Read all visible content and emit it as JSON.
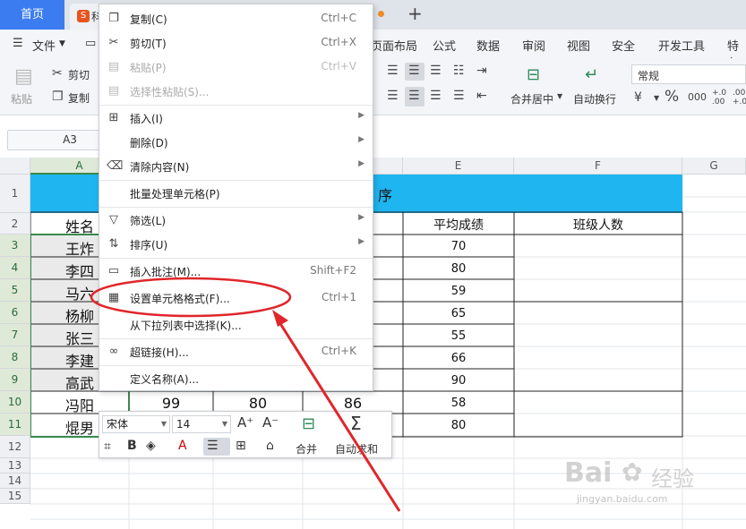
{
  "tabs": {
    "home": "首页",
    "doc_icon": "S",
    "doc_partial": "科"
  },
  "menu": [
    "文件",
    "页面布局",
    "公式",
    "数据",
    "审阅",
    "视图",
    "安全",
    "开发工具",
    "特色"
  ],
  "toolbar": {
    "paste": "粘贴",
    "cut": "剪切",
    "copy": "复制",
    "merge": "合并居中",
    "wrap": "自动换行",
    "number_format": "常规",
    "percent": "%",
    "thousands": "000",
    "inc_dec": "+.0 .00",
    "dec_dec": ".00 +.0"
  },
  "formula": {
    "name_box": "A3"
  },
  "columns": [
    "A",
    "E",
    "F",
    "G"
  ],
  "rows": [
    "1",
    "2",
    "3",
    "4",
    "5",
    "6",
    "7",
    "8",
    "9",
    "10",
    "11",
    "12",
    "13",
    "14",
    "15"
  ],
  "sheet": {
    "title_partial": "序",
    "col_a_header": "姓名",
    "avg_header": "平均成绩",
    "class_header": "班级人数",
    "names": [
      "王炸",
      "李四",
      "马六",
      "杨柳",
      "张三",
      "李建",
      "高武",
      "冯阳",
      "焜男"
    ],
    "averages": [
      "70",
      "80",
      "59",
      "65",
      "55",
      "66",
      "90",
      "58",
      "80"
    ],
    "row10": {
      "b": "99",
      "c": "80",
      "d": "86"
    }
  },
  "context_menu": [
    {
      "icon": "copy-icon",
      "label": "复制(C)",
      "shortcut": "Ctrl+C"
    },
    {
      "icon": "cut-icon",
      "label": "剪切(T)",
      "shortcut": "Ctrl+X"
    },
    {
      "icon": "paste-icon",
      "label": "粘贴(P)",
      "shortcut": "Ctrl+V",
      "disabled": true
    },
    {
      "icon": "paste-special-icon",
      "label": "选择性粘贴(S)...",
      "disabled": true
    },
    {
      "icon": "insert-icon",
      "label": "插入(I)",
      "submenu": true
    },
    {
      "icon": "",
      "label": "删除(D)",
      "submenu": true
    },
    {
      "icon": "eraser-icon",
      "label": "清除内容(N)",
      "submenu": true
    },
    {
      "icon": "",
      "label": "批量处理单元格(P)"
    },
    {
      "icon": "filter-icon",
      "label": "筛选(L)",
      "submenu": true
    },
    {
      "icon": "sort-icon",
      "label": "排序(U)",
      "submenu": true
    },
    {
      "icon": "comment-icon",
      "label": "插入批注(M)...",
      "shortcut": "Shift+F2"
    },
    {
      "icon": "format-cells-icon",
      "label": "设置单元格格式(F)...",
      "shortcut": "Ctrl+1"
    },
    {
      "icon": "",
      "label": "从下拉列表中选择(K)..."
    },
    {
      "icon": "link-icon",
      "label": "超链接(H)...",
      "shortcut": "Ctrl+K"
    },
    {
      "icon": "",
      "label": "定义名称(A)..."
    }
  ],
  "mini_toolbar": {
    "font": "宋体",
    "size": "14",
    "merge": "合并",
    "autosum": "自动求和"
  },
  "watermark": {
    "brand": "Bai",
    "brand2": "经验",
    "url": "jingyan.baidu.com"
  },
  "colors": {
    "accent": "#3b7cf0",
    "header_fill": "#1fb5f0",
    "annotation": "#e0262a",
    "selection": "#3a8a4c"
  }
}
